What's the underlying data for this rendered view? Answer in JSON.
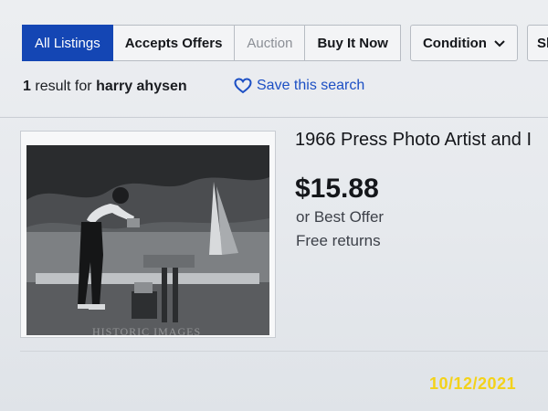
{
  "filters": {
    "all_listings": "All Listings",
    "accepts_offers": "Accepts Offers",
    "auction": "Auction",
    "buy_it_now": "Buy It Now",
    "condition": "Condition",
    "shipping": "Shi"
  },
  "results": {
    "count": "1",
    "text": "result for",
    "query": "harry ahysen",
    "save_search": "Save this search"
  },
  "listing": {
    "title": "1966 Press Photo Artist and I",
    "price": "$15.88",
    "offer": "or Best Offer",
    "returns": "Free returns",
    "watermark": "HISTORIC IMAGES"
  },
  "photo_timestamp": "10/12/2021",
  "icons": {
    "save": "heart-icon",
    "condition": "chevron-down-icon"
  },
  "colors": {
    "accent": "#1446b4",
    "link": "#1c4fc4",
    "timestamp": "#f3d21a"
  }
}
